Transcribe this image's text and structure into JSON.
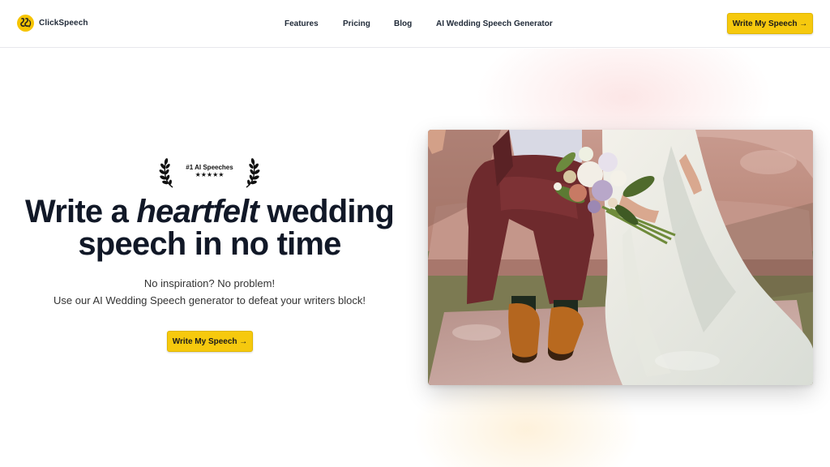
{
  "brand": {
    "name": "ClickSpeech",
    "logo_icon": "speech-logo-icon"
  },
  "nav": {
    "items": [
      {
        "label": "Features"
      },
      {
        "label": "Pricing"
      },
      {
        "label": "Blog"
      },
      {
        "label": "AI Wedding Speech Generator"
      }
    ]
  },
  "header": {
    "cta_label": "Write My Speech →"
  },
  "badge": {
    "text": "#1 AI Speeches",
    "stars": "★★★★★",
    "rating": 5
  },
  "hero": {
    "headline_before": "Write a ",
    "headline_emphasis": "heartfelt",
    "headline_after": " wedding speech in no time",
    "subtitle_line1": "No inspiration? No problem!",
    "subtitle_line2": "Use our AI Wedding Speech generator to defeat your writers block!",
    "cta_label": "Write My Speech →"
  },
  "colors": {
    "accent": "#f6c90e",
    "text": "#111827",
    "border": "#e8e8ec"
  }
}
